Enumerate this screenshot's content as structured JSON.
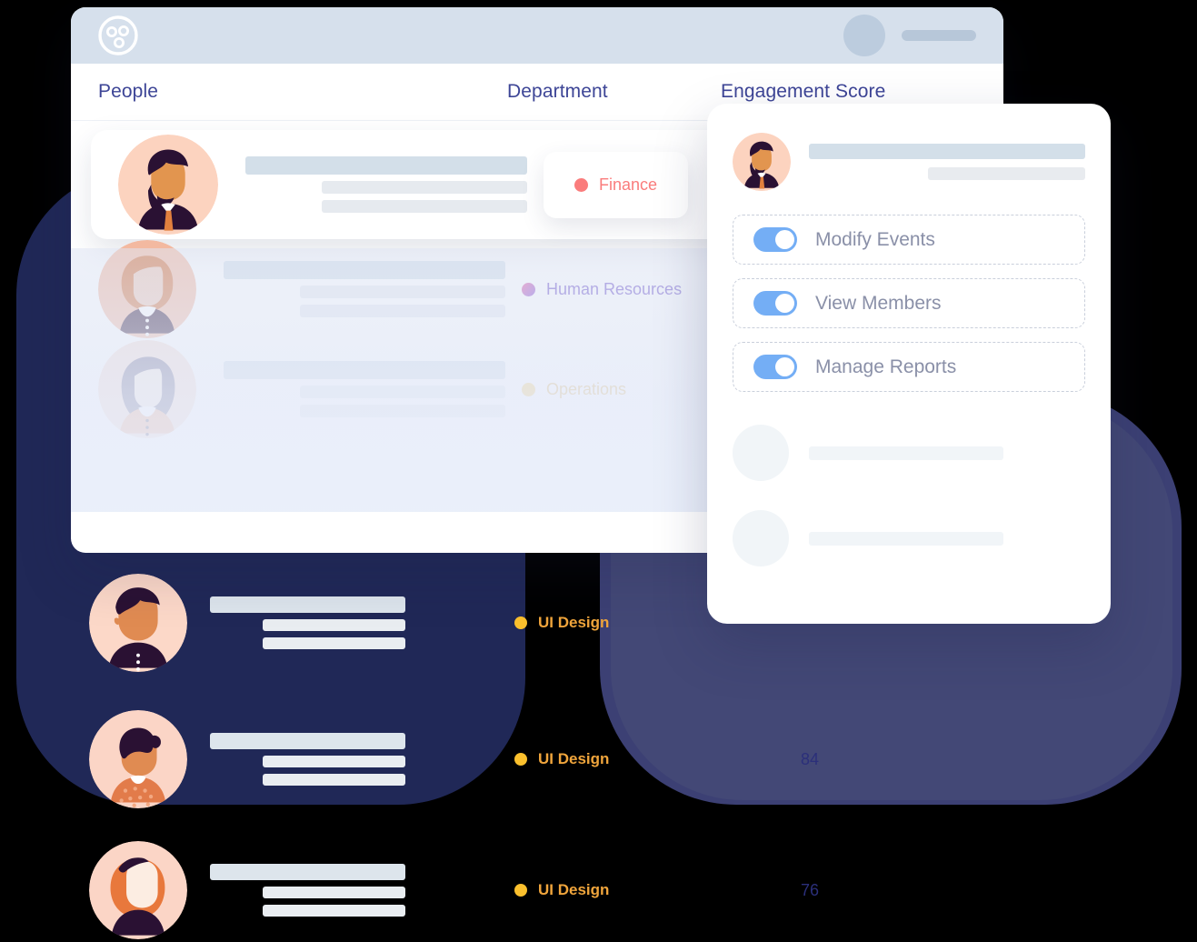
{
  "app": {
    "logo_icon": "people-group-logo-icon",
    "header_avatar_icon": "user-avatar-placeholder",
    "header_name_placeholder": ""
  },
  "table": {
    "columns": [
      "People",
      "Department",
      "Engagement Score"
    ],
    "rows": [
      {
        "avatar_icon": "avatar-man-beard-tie",
        "department": "Finance",
        "dept_color": "#FA7C7C",
        "score": ""
      },
      {
        "avatar_icon": "avatar-woman-bob",
        "department": "Human Resources",
        "dept_color": "#A755D8",
        "score": ""
      },
      {
        "avatar_icon": "avatar-woman-longhair",
        "department": "Operations",
        "dept_color": "#F5CE6B",
        "score": ""
      },
      {
        "avatar_icon": "avatar-man-dark-shirt",
        "department": "UI Design",
        "dept_color": "#FBC02D",
        "score": ""
      },
      {
        "avatar_icon": "avatar-woman-bun",
        "department": "UI Design",
        "dept_color": "#FBC02D",
        "score": "84"
      },
      {
        "avatar_icon": "avatar-woman-red-hair",
        "department": "UI Design",
        "dept_color": "#FBC02D",
        "score": "76"
      }
    ]
  },
  "popover": {
    "user_avatar_icon": "avatar-man-beard-tie",
    "permissions": [
      {
        "label": "Modify Events",
        "enabled": true
      },
      {
        "label": "View Members",
        "enabled": true
      },
      {
        "label": "Manage Reports",
        "enabled": true
      }
    ],
    "skeleton_rows": 2
  },
  "colors": {
    "header_bg": "#D6E0EC",
    "column_header_text": "#3D4596",
    "toggle_on": "#74AEF5",
    "blob_dark": "#222A5C",
    "blob_light": "#3C4074",
    "score_text": "#2B2F7A"
  }
}
